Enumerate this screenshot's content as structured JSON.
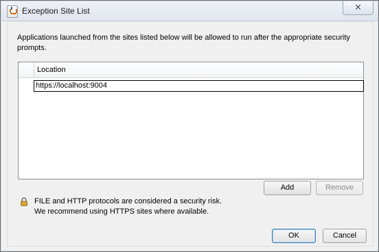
{
  "window": {
    "title": "Exception Site List",
    "close_label": "✕"
  },
  "description": "Applications launched from the sites listed below will be allowed to run after the appropriate security prompts.",
  "table": {
    "column_header": "Location",
    "rows": [
      {
        "location": "https://localhost:9004"
      }
    ]
  },
  "buttons": {
    "add": "Add",
    "remove": "Remove",
    "ok": "OK",
    "cancel": "Cancel"
  },
  "warning": {
    "line1": "FILE and HTTP protocols are considered a security risk.",
    "line2": "We recommend using HTTPS sites where available.",
    "icon": "lock-icon"
  },
  "colors": {
    "lock_body": "#d8a42b"
  }
}
